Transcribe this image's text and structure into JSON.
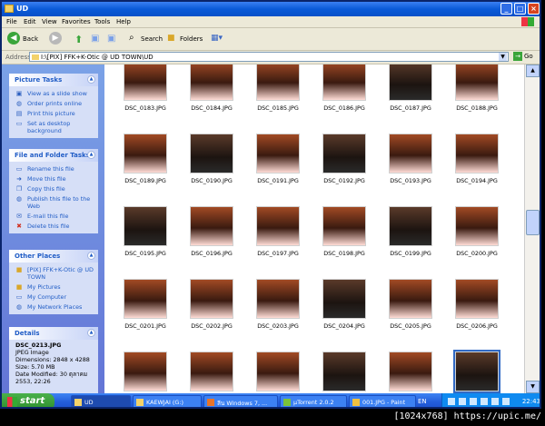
{
  "window": {
    "title": "UD"
  },
  "menu": [
    "File",
    "Edit",
    "View",
    "Favorites",
    "Tools",
    "Help"
  ],
  "toolbar": {
    "back": "Back",
    "search": "Search",
    "folders": "Folders"
  },
  "address": {
    "label": "Address",
    "path": "I:\\[PIX] FFK+K-Otic @ UD TOWN\\UD",
    "go": "Go"
  },
  "picture_tasks": {
    "title": "Picture Tasks",
    "items": [
      "View as a slide show",
      "Order prints online",
      "Print this picture",
      "Set as desktop background"
    ]
  },
  "file_tasks": {
    "title": "File and Folder Tasks",
    "items": [
      "Rename this file",
      "Move this file",
      "Copy this file",
      "Publish this file to the Web",
      "E-mail this file",
      "Delete this file"
    ]
  },
  "other_places": {
    "title": "Other Places",
    "items": [
      "[PIX] FFK+K-Otic @ UD TOWN",
      "My Pictures",
      "My Computer",
      "My Network Places"
    ]
  },
  "details": {
    "title": "Details",
    "name": "DSC_0213.JPG",
    "type": "JPEG Image",
    "dimensions": "Dimensions: 2848 x 4288",
    "size": "Size: 5.70 MB",
    "modified": "Date Modified: 30 ตุลาคม 2553, 22:26"
  },
  "files": [
    "DSC_0183.JPG",
    "DSC_0184.JPG",
    "DSC_0185.JPG",
    "DSC_0186.JPG",
    "DSC_0187.JPG",
    "DSC_0188.JPG",
    "DSC_0189.JPG",
    "DSC_0190.JPG",
    "DSC_0191.JPG",
    "DSC_0192.JPG",
    "DSC_0193.JPG",
    "DSC_0194.JPG",
    "DSC_0195.JPG",
    "DSC_0196.JPG",
    "DSC_0197.JPG",
    "DSC_0198.JPG",
    "DSC_0199.JPG",
    "DSC_0200.JPG",
    "DSC_0201.JPG",
    "DSC_0202.JPG",
    "DSC_0203.JPG",
    "DSC_0204.JPG",
    "DSC_0205.JPG",
    "DSC_0206.JPG",
    "",
    "",
    "",
    "",
    "",
    ""
  ],
  "taskbar": {
    "start": "start",
    "tasks": [
      "UD",
      "KAEWJAI (G:)",
      "ลีน Windows 7, ...",
      "µTorrent 2.0.2",
      "001.JPG - Paint"
    ],
    "lang": "EN",
    "clock": "22:43"
  },
  "watermark": "[1024x768] https://upic.me/"
}
